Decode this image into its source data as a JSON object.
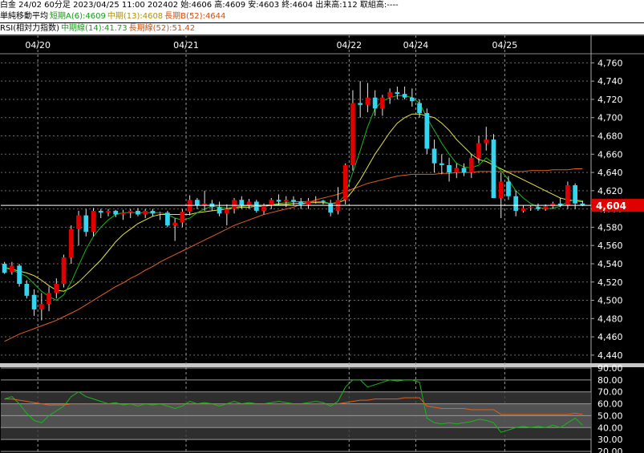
{
  "header": {
    "line1": "白金 24/02 60分足 2023/04/25 11:00 202402 始:4606 高:4609 安:4603 終:4604 出来高:112 取組高:----",
    "line2_label": "単純移動平均",
    "ma_short": "短期A(6):4609",
    "ma_mid": "中期(13):4608",
    "ma_long": "長期B(52):4644",
    "line3_label": "RSI(相対力指数)",
    "rsi_mid": "中期線(14):41.73",
    "rsi_long": "長期線(52):51.42"
  },
  "colors": {
    "up": "#e00000",
    "down": "#33d6f0",
    "ma_short": "#18b818",
    "ma_mid": "#e6e640",
    "ma_long": "#e06020",
    "last_price_bg": "#e00000"
  },
  "chart_data": [
    {
      "type": "candlestick",
      "date_labels": [
        "04/20",
        "04/21",
        "04/22",
        "04/24",
        "04/25"
      ],
      "y_ticks": [
        4440,
        4460,
        4480,
        4500,
        4520,
        4540,
        4560,
        4580,
        4600,
        4620,
        4640,
        4660,
        4680,
        4700,
        4720,
        4740,
        4760
      ],
      "y_tick_labels": [
        "4,440",
        "4,460",
        "4,480",
        "4,500",
        "4,520",
        "4,540",
        "4,560",
        "4,580",
        "4,600",
        "4,620",
        "4,640",
        "4,660",
        "4,680",
        "4,700",
        "4,720",
        "4,740",
        "4,760"
      ],
      "ylim": [
        4432,
        4770
      ],
      "last_price": 4604,
      "last_price_label": "4,604",
      "ohlc": [
        [
          4540,
          4542,
          4529,
          4530
        ],
        [
          4531,
          4542,
          4528,
          4538
        ],
        [
          4538,
          4540,
          4515,
          4518
        ],
        [
          4518,
          4522,
          4502,
          4505
        ],
        [
          4506,
          4512,
          4483,
          4490
        ],
        [
          4490,
          4508,
          4478,
          4496
        ],
        [
          4496,
          4515,
          4488,
          4508
        ],
        [
          4508,
          4524,
          4502,
          4518
        ],
        [
          4518,
          4550,
          4514,
          4547
        ],
        [
          4547,
          4582,
          4540,
          4578
        ],
        [
          4578,
          4598,
          4560,
          4593
        ],
        [
          4593,
          4600,
          4570,
          4575
        ],
        [
          4575,
          4601,
          4570,
          4598
        ],
        [
          4598,
          4600,
          4590,
          4596
        ],
        [
          4596,
          4600,
          4592,
          4598
        ],
        [
          4598,
          4599,
          4591,
          4594
        ],
        [
          4594,
          4599,
          4588,
          4596
        ],
        [
          4596,
          4600,
          4590,
          4598
        ],
        [
          4598,
          4601,
          4592,
          4594
        ],
        [
          4594,
          4600,
          4590,
          4598
        ],
        [
          4598,
          4600,
          4592,
          4595
        ],
        [
          4595,
          4597,
          4588,
          4596
        ],
        [
          4596,
          4598,
          4580,
          4582
        ],
        [
          4582,
          4590,
          4565,
          4585
        ],
        [
          4585,
          4600,
          4580,
          4597
        ],
        [
          4597,
          4615,
          4593,
          4610
        ],
        [
          4610,
          4612,
          4600,
          4604
        ],
        [
          4604,
          4620,
          4598,
          4606
        ],
        [
          4606,
          4610,
          4598,
          4602
        ],
        [
          4602,
          4608,
          4592,
          4595
        ],
        [
          4595,
          4605,
          4582,
          4600
        ],
        [
          4600,
          4612,
          4595,
          4610
        ],
        [
          4610,
          4614,
          4600,
          4604
        ],
        [
          4604,
          4611,
          4600,
          4608
        ],
        [
          4608,
          4610,
          4596,
          4598
        ],
        [
          4598,
          4606,
          4594,
          4604
        ],
        [
          4604,
          4612,
          4600,
          4610
        ],
        [
          4610,
          4616,
          4604,
          4608
        ],
        [
          4608,
          4614,
          4602,
          4610
        ],
        [
          4610,
          4614,
          4604,
          4608
        ],
        [
          4608,
          4612,
          4600,
          4605
        ],
        [
          4605,
          4612,
          4600,
          4609
        ],
        [
          4609,
          4614,
          4606,
          4609
        ],
        [
          4609,
          4610,
          4605,
          4608
        ],
        [
          4606,
          4610,
          4592,
          4596
        ],
        [
          4598,
          4624,
          4594,
          4610
        ],
        [
          4610,
          4650,
          4605,
          4648
        ],
        [
          4648,
          4730,
          4642,
          4716
        ],
        [
          4716,
          4740,
          4700,
          4714
        ],
        [
          4714,
          4738,
          4706,
          4722
        ],
        [
          4722,
          4730,
          4702,
          4710
        ],
        [
          4710,
          4725,
          4702,
          4722
        ],
        [
          4722,
          4732,
          4715,
          4728
        ],
        [
          4728,
          4734,
          4720,
          4726
        ],
        [
          4726,
          4734,
          4720,
          4722
        ],
        [
          4722,
          4732,
          4712,
          4718
        ],
        [
          4716,
          4720,
          4700,
          4705
        ],
        [
          4705,
          4710,
          4660,
          4666
        ],
        [
          4666,
          4676,
          4640,
          4650
        ],
        [
          4650,
          4660,
          4638,
          4648
        ],
        [
          4648,
          4656,
          4630,
          4640
        ],
        [
          4640,
          4650,
          4634,
          4645
        ],
        [
          4645,
          4650,
          4636,
          4640
        ],
        [
          4640,
          4660,
          4634,
          4656
        ],
        [
          4656,
          4680,
          4650,
          4672
        ],
        [
          4672,
          4690,
          4664,
          4676
        ],
        [
          4676,
          4682,
          4630,
          4612
        ],
        [
          4612,
          4640,
          4590,
          4630
        ],
        [
          4630,
          4636,
          4610,
          4614
        ],
        [
          4614,
          4620,
          4592,
          4598
        ],
        [
          4598,
          4604,
          4596,
          4601
        ],
        [
          4601,
          4604,
          4598,
          4602
        ],
        [
          4602,
          4606,
          4598,
          4600
        ],
        [
          4600,
          4605,
          4598,
          4603
        ],
        [
          4603,
          4608,
          4600,
          4606
        ],
        [
          4606,
          4612,
          4602,
          4604
        ],
        [
          4604,
          4630,
          4600,
          4626
        ],
        [
          4626,
          4628,
          4600,
          4606
        ],
        [
          4606,
          4609,
          4603,
          4604
        ]
      ],
      "ma_short_values": [
        4536,
        4533,
        4530,
        4526,
        4518,
        4510,
        4504,
        4500,
        4506,
        4520,
        4538,
        4556,
        4570,
        4580,
        4588,
        4594,
        4596,
        4596,
        4596,
        4596,
        4596,
        4596,
        4594,
        4590,
        4588,
        4590,
        4596,
        4600,
        4603,
        4602,
        4601,
        4602,
        4603,
        4604,
        4604,
        4604,
        4605,
        4606,
        4607,
        4608,
        4608,
        4608,
        4608,
        4608,
        4606,
        4606,
        4616,
        4640,
        4664,
        4690,
        4710,
        4718,
        4722,
        4724,
        4724,
        4722,
        4716,
        4700,
        4686,
        4672,
        4660,
        4650,
        4646,
        4645,
        4648,
        4656,
        4650,
        4642,
        4632,
        4620,
        4612,
        4606,
        4602,
        4600,
        4601,
        4603,
        4608,
        4610,
        4609
      ],
      "ma_mid_values": [
        4536,
        4534,
        4532,
        4530,
        4527,
        4522,
        4516,
        4511,
        4510,
        4514,
        4520,
        4528,
        4536,
        4544,
        4554,
        4564,
        4572,
        4578,
        4584,
        4588,
        4592,
        4594,
        4594,
        4594,
        4594,
        4594,
        4596,
        4597,
        4598,
        4599,
        4600,
        4601,
        4602,
        4602,
        4603,
        4603,
        4604,
        4605,
        4605,
        4606,
        4606,
        4607,
        4607,
        4607,
        4606,
        4607,
        4610,
        4620,
        4632,
        4646,
        4660,
        4672,
        4684,
        4694,
        4700,
        4704,
        4704,
        4702,
        4700,
        4694,
        4686,
        4676,
        4668,
        4660,
        4654,
        4652,
        4648,
        4644,
        4640,
        4636,
        4632,
        4628,
        4624,
        4620,
        4616,
        4612,
        4610,
        4609,
        4608
      ],
      "ma_long_values": [
        4455,
        4459,
        4463,
        4466,
        4469,
        4472,
        4475,
        4478,
        4482,
        4486,
        4490,
        4495,
        4500,
        4505,
        4510,
        4515,
        4519,
        4524,
        4528,
        4533,
        4537,
        4542,
        4546,
        4550,
        4554,
        4558,
        4562,
        4566,
        4570,
        4574,
        4578,
        4582,
        4585,
        4588,
        4591,
        4594,
        4596,
        4598,
        4600,
        4602,
        4605,
        4607,
        4610,
        4612,
        4614,
        4616,
        4619,
        4622,
        4625,
        4628,
        4630,
        4632,
        4634,
        4636,
        4637,
        4638,
        4638,
        4638,
        4638,
        4639,
        4639,
        4640,
        4640,
        4640,
        4641,
        4641,
        4641,
        4641,
        4641,
        4641,
        4641,
        4642,
        4642,
        4642,
        4643,
        4643,
        4643,
        4644,
        4644
      ]
    },
    {
      "type": "line",
      "y_ticks": [
        20,
        30,
        40,
        50,
        60,
        70,
        80,
        90
      ],
      "y_tick_labels": [
        "20.00",
        "30.00",
        "40.00",
        "50.00",
        "60.00",
        "70.00",
        "80.00",
        "90.00"
      ],
      "ylim": [
        20,
        90
      ],
      "bands": [
        [
          30,
          70
        ],
        [
          40,
          60
        ]
      ],
      "series": [
        {
          "values": [
            64,
            66,
            60,
            52,
            46,
            44,
            50,
            54,
            58,
            66,
            70,
            66,
            64,
            62,
            60,
            61,
            59,
            60,
            58,
            60,
            59,
            60,
            58,
            56,
            58,
            62,
            60,
            61,
            60,
            58,
            60,
            62,
            60,
            61,
            60,
            60,
            61,
            62,
            61,
            60,
            60,
            61,
            62,
            61,
            58,
            62,
            74,
            80,
            80,
            74,
            76,
            78,
            80,
            79,
            80,
            80,
            78,
            48,
            44,
            43,
            44,
            43,
            44,
            45,
            47,
            46,
            44,
            36,
            38,
            40,
            41,
            40,
            41,
            40,
            42,
            40,
            44,
            48,
            42
          ]
        },
        {
          "values": [
            64,
            64,
            63,
            62,
            61,
            60,
            59,
            59,
            59,
            60,
            60,
            60,
            60,
            60,
            60,
            60,
            60,
            60,
            60,
            60,
            60,
            60,
            60,
            60,
            60,
            60,
            60,
            60,
            60,
            60,
            60,
            60,
            60,
            60,
            60,
            60,
            60,
            60,
            60,
            60,
            60,
            60,
            60,
            60,
            60,
            60,
            61,
            62,
            63,
            63,
            64,
            64,
            64,
            64,
            65,
            65,
            65,
            58,
            57,
            56,
            56,
            56,
            56,
            55,
            55,
            55,
            55,
            51,
            51,
            51,
            51,
            51,
            51,
            51,
            51,
            51,
            51,
            52,
            51
          ]
        }
      ]
    }
  ]
}
